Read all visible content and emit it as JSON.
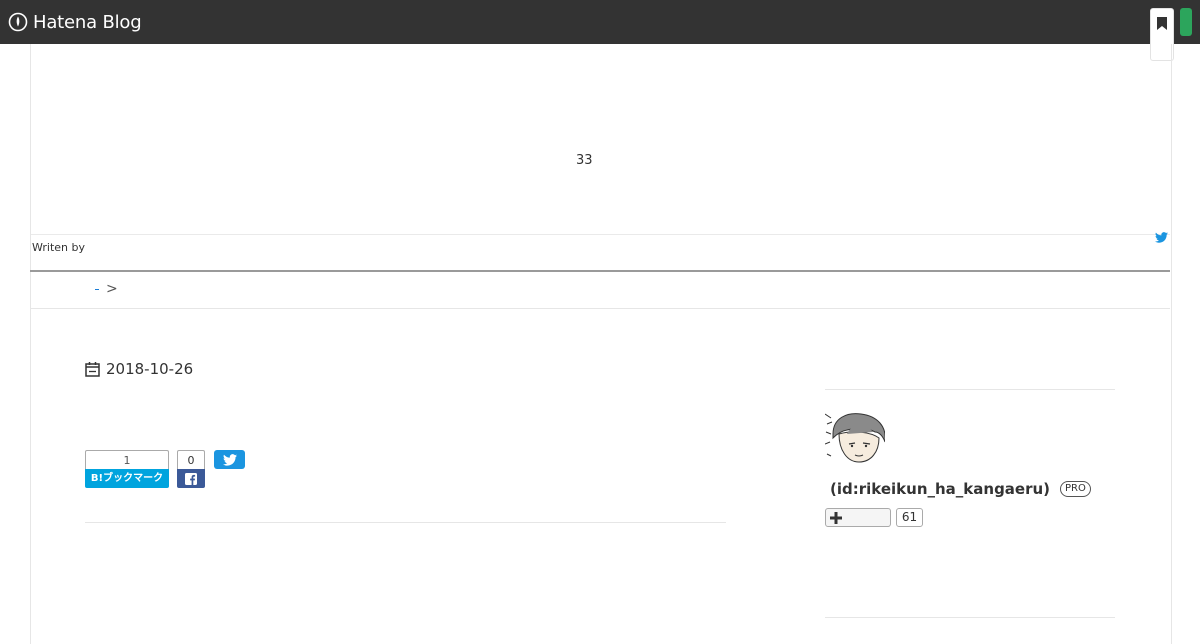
{
  "header": {
    "logo_text": "Hatena Blog"
  },
  "entry": {
    "count_text": "33",
    "writen_by": "Writen by",
    "date": "2018-10-26"
  },
  "breadcrumb": {
    "separator": ">"
  },
  "share": {
    "hatena_count": "1",
    "hatena_label": "B!ブックマーク",
    "facebook_count": "0"
  },
  "profile": {
    "name": "(id:rikeikun_ha_kangaeru)",
    "badge": "PRO",
    "follower_count": "61"
  },
  "colors": {
    "header_bg": "#333333",
    "accent_green": "#2ca55c",
    "hatena_blue": "#00a4de",
    "facebook_blue": "#3b5998",
    "twitter_blue": "#1b95e0"
  }
}
